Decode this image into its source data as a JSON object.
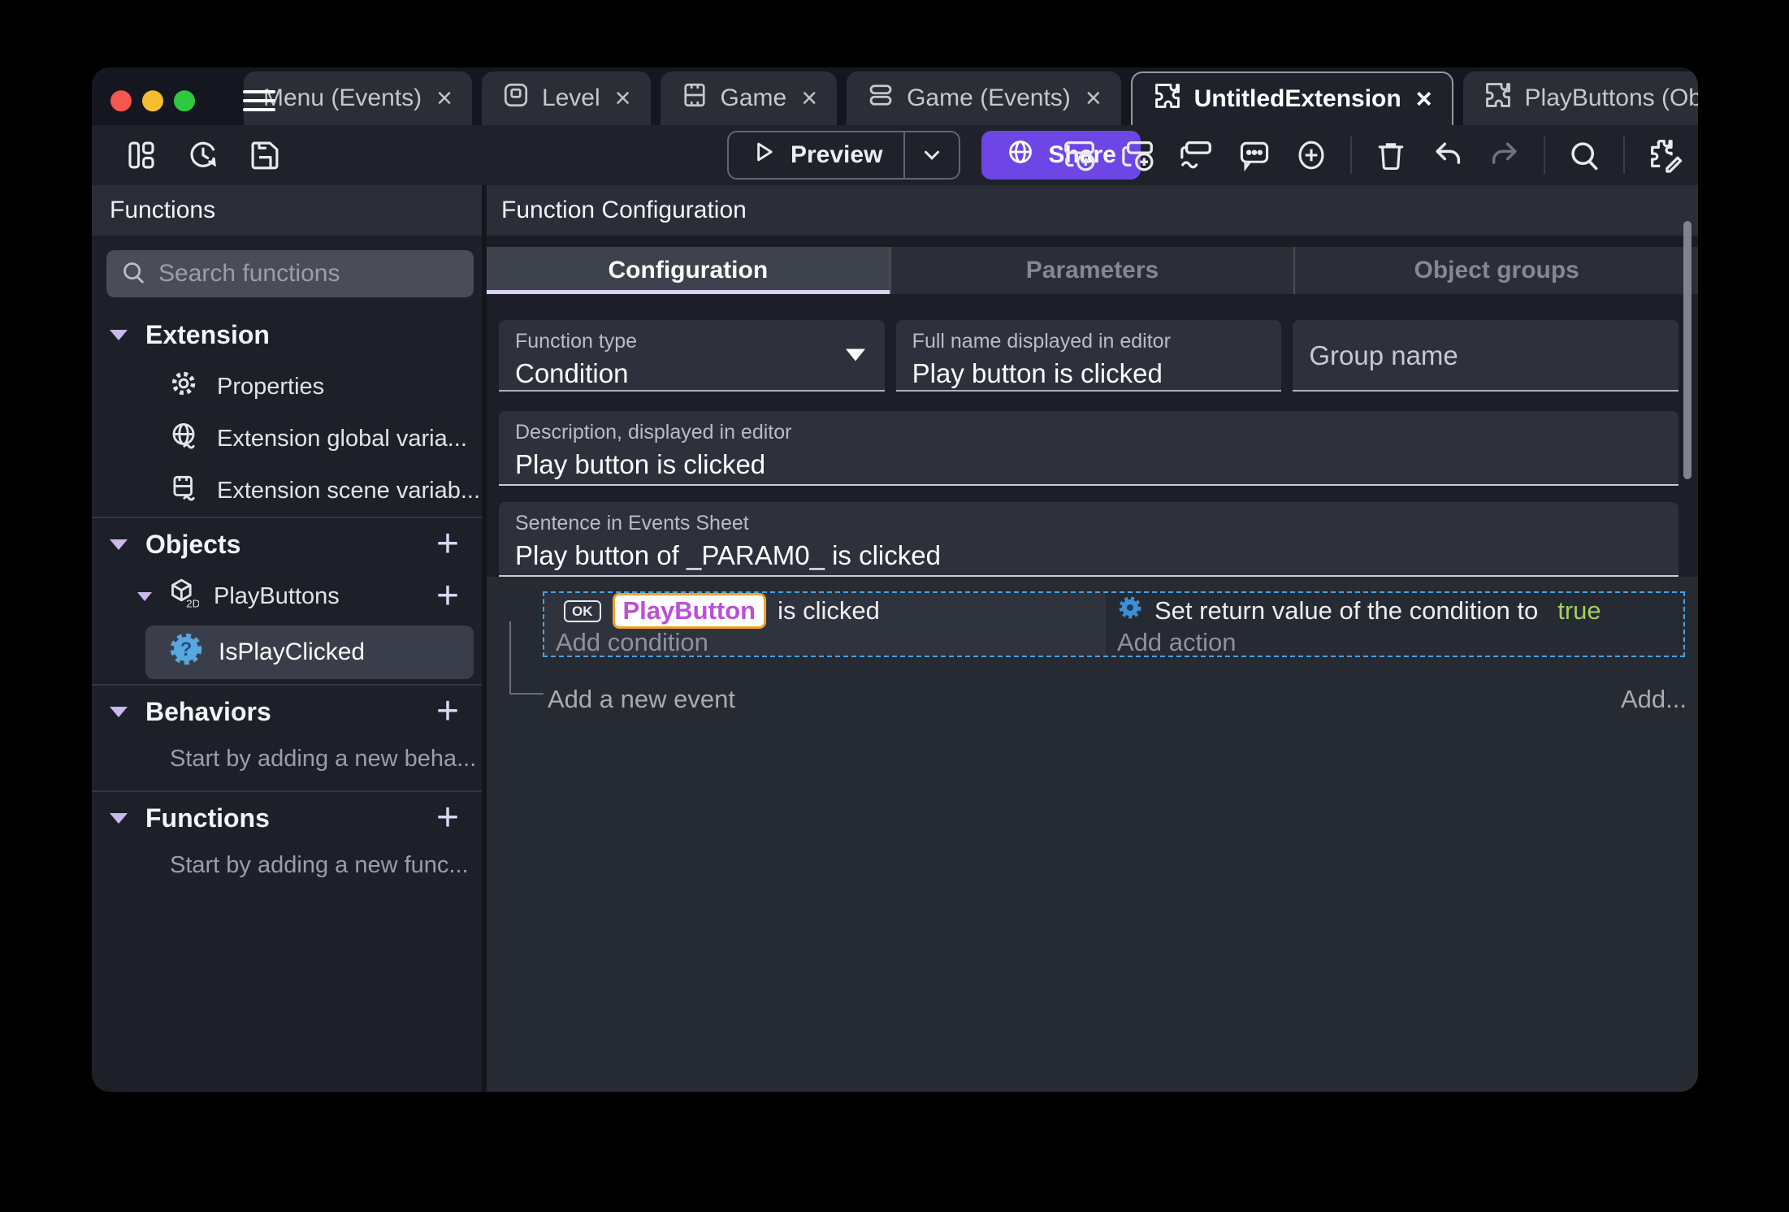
{
  "titlebar": {
    "close_glyph": "×",
    "tabs": [
      {
        "label": "Menu (Events)"
      },
      {
        "label": "Level"
      },
      {
        "label": "Game"
      },
      {
        "label": "Game (Events)"
      },
      {
        "label": "UntitledExtension"
      },
      {
        "label": "PlayButtons (Object)"
      }
    ]
  },
  "toolbar": {
    "preview_label": "Preview",
    "share_label": "Share"
  },
  "sidebar": {
    "title": "Functions",
    "search_placeholder": "Search functions",
    "extension": {
      "title": "Extension",
      "items": [
        "Properties",
        "Extension global varia...",
        "Extension scene variab..."
      ]
    },
    "objects": {
      "title": "Objects",
      "object_name": "PlayButtons",
      "function_name": "IsPlayClicked"
    },
    "behaviors": {
      "title": "Behaviors",
      "empty": "Start by adding a new beha..."
    },
    "functions": {
      "title": "Functions",
      "empty": "Start by adding a new func..."
    }
  },
  "main": {
    "title": "Function Configuration",
    "tabs": [
      {
        "label": "Configuration"
      },
      {
        "label": "Parameters"
      },
      {
        "label": "Object groups"
      }
    ],
    "function_type": {
      "label": "Function type",
      "value": "Condition"
    },
    "full_name": {
      "label": "Full name displayed in editor",
      "value": "Play button is clicked"
    },
    "group_name": {
      "placeholder": "Group name"
    },
    "description": {
      "label": "Description, displayed in editor",
      "value": "Play button is clicked"
    },
    "sentence": {
      "label": "Sentence in Events Sheet",
      "value": "Play button of _PARAM0_ is clicked"
    },
    "events": {
      "ok_badge": "OK",
      "condition_object": "PlayButton",
      "condition_suffix": "is clicked",
      "add_condition": "Add condition",
      "action_prefix": "Set return value of the condition to",
      "action_value": "true",
      "add_action": "Add action",
      "add_new_event": "Add a new event",
      "add_more": "Add..."
    }
  },
  "colors": {
    "accent_violet": "#6e46e6",
    "selection_blue": "#4aa3e0",
    "true_green": "#a5ce61",
    "chip_text": "#bb4fd8",
    "chip_border": "#f0a22a"
  }
}
